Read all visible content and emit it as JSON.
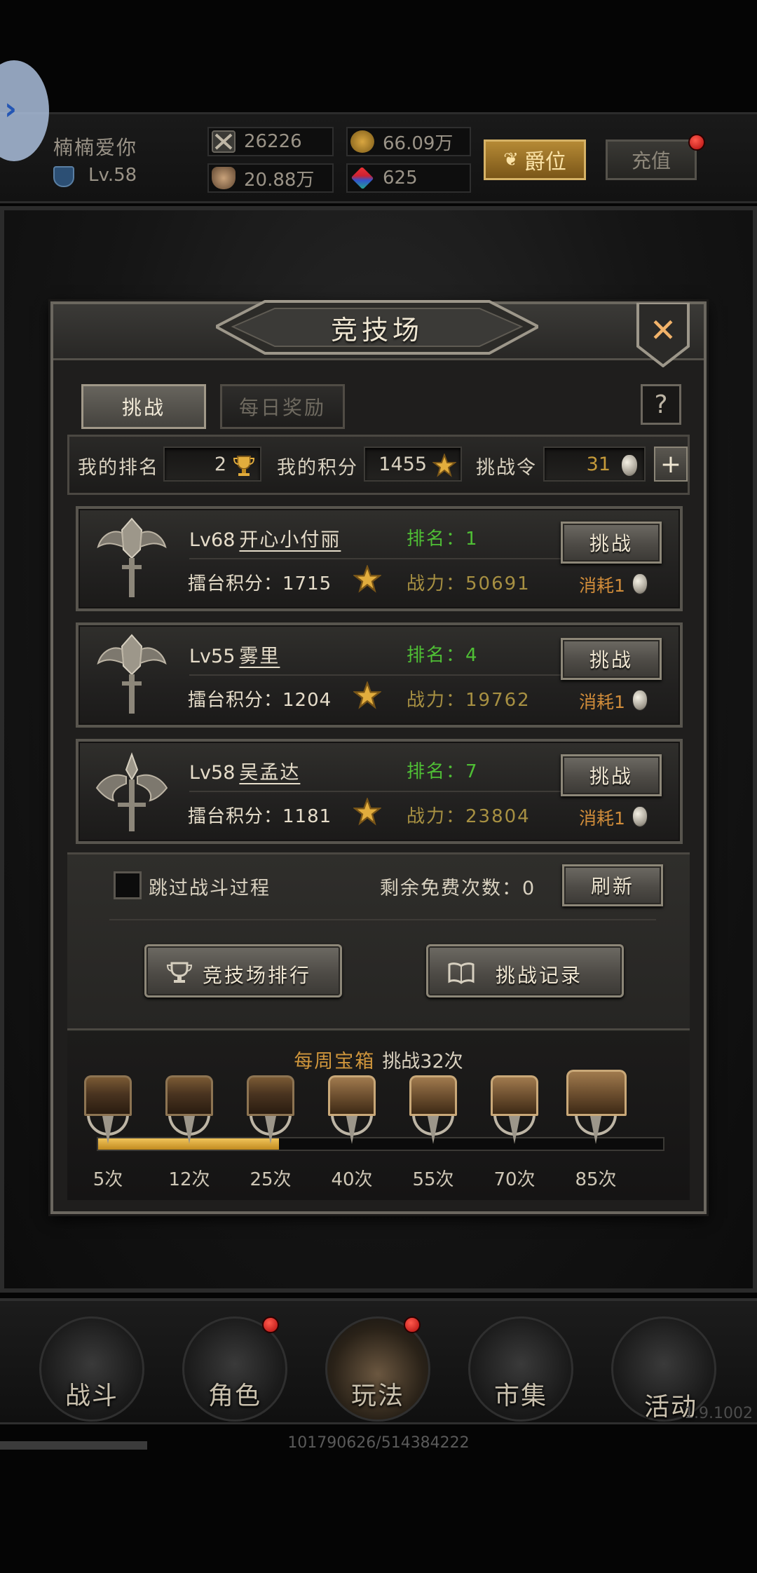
{
  "player": {
    "name": "楠楠爱你",
    "level": "Lv.58",
    "stats": {
      "attack": "26226",
      "gold": "66.09万",
      "defense": "20.88万",
      "gems": "625"
    },
    "title_button": "爵位",
    "recharge_button": "充值"
  },
  "arena": {
    "title": "竞技场",
    "tabs": [
      "挑战",
      "每日奖励"
    ],
    "help": "?",
    "my_rank_label": "我的排名",
    "my_rank": "2",
    "my_score_label": "我的积分",
    "my_score": "1455",
    "tokens_label": "挑战令",
    "tokens": "31",
    "opponents": [
      {
        "level": "Lv68",
        "name": "开心小付丽",
        "score": "擂台积分：1715",
        "rank": "排名：1",
        "power": "战力：50691",
        "button": "挑战",
        "cost": "消耗1"
      },
      {
        "level": "Lv55",
        "name": "雾里",
        "score": "擂台积分：1204",
        "rank": "排名：4",
        "power": "战力：19762",
        "button": "挑战",
        "cost": "消耗1"
      },
      {
        "level": "Lv58",
        "name": "吴孟达",
        "score": "擂台积分：1181",
        "rank": "排名：7",
        "power": "战力：23804",
        "button": "挑战",
        "cost": "消耗1"
      }
    ],
    "skip_battle": "跳过战斗过程",
    "free_refresh": "剩余免费次数：0",
    "refresh_button": "刷新",
    "ranking_button": "竞技场排行",
    "record_button": "挑战记录",
    "weekly_title": "每周宝箱",
    "weekly_count": "挑战32次",
    "weekly_progress": 0.32,
    "milestones": [
      "5次",
      "12次",
      "25次",
      "40次",
      "55次",
      "70次",
      "85次"
    ]
  },
  "nav": [
    "战斗",
    "角色",
    "玩法",
    "市集",
    "活动"
  ],
  "version": "1.9.1002",
  "loading": "101790626/514384222",
  "colors": {
    "rank_green": "#4fbf35",
    "power_gold": "#a79042",
    "cost_orange": "#d08c3a",
    "progress_gold": "#e2ad3d",
    "notify_red": "#d42020"
  }
}
